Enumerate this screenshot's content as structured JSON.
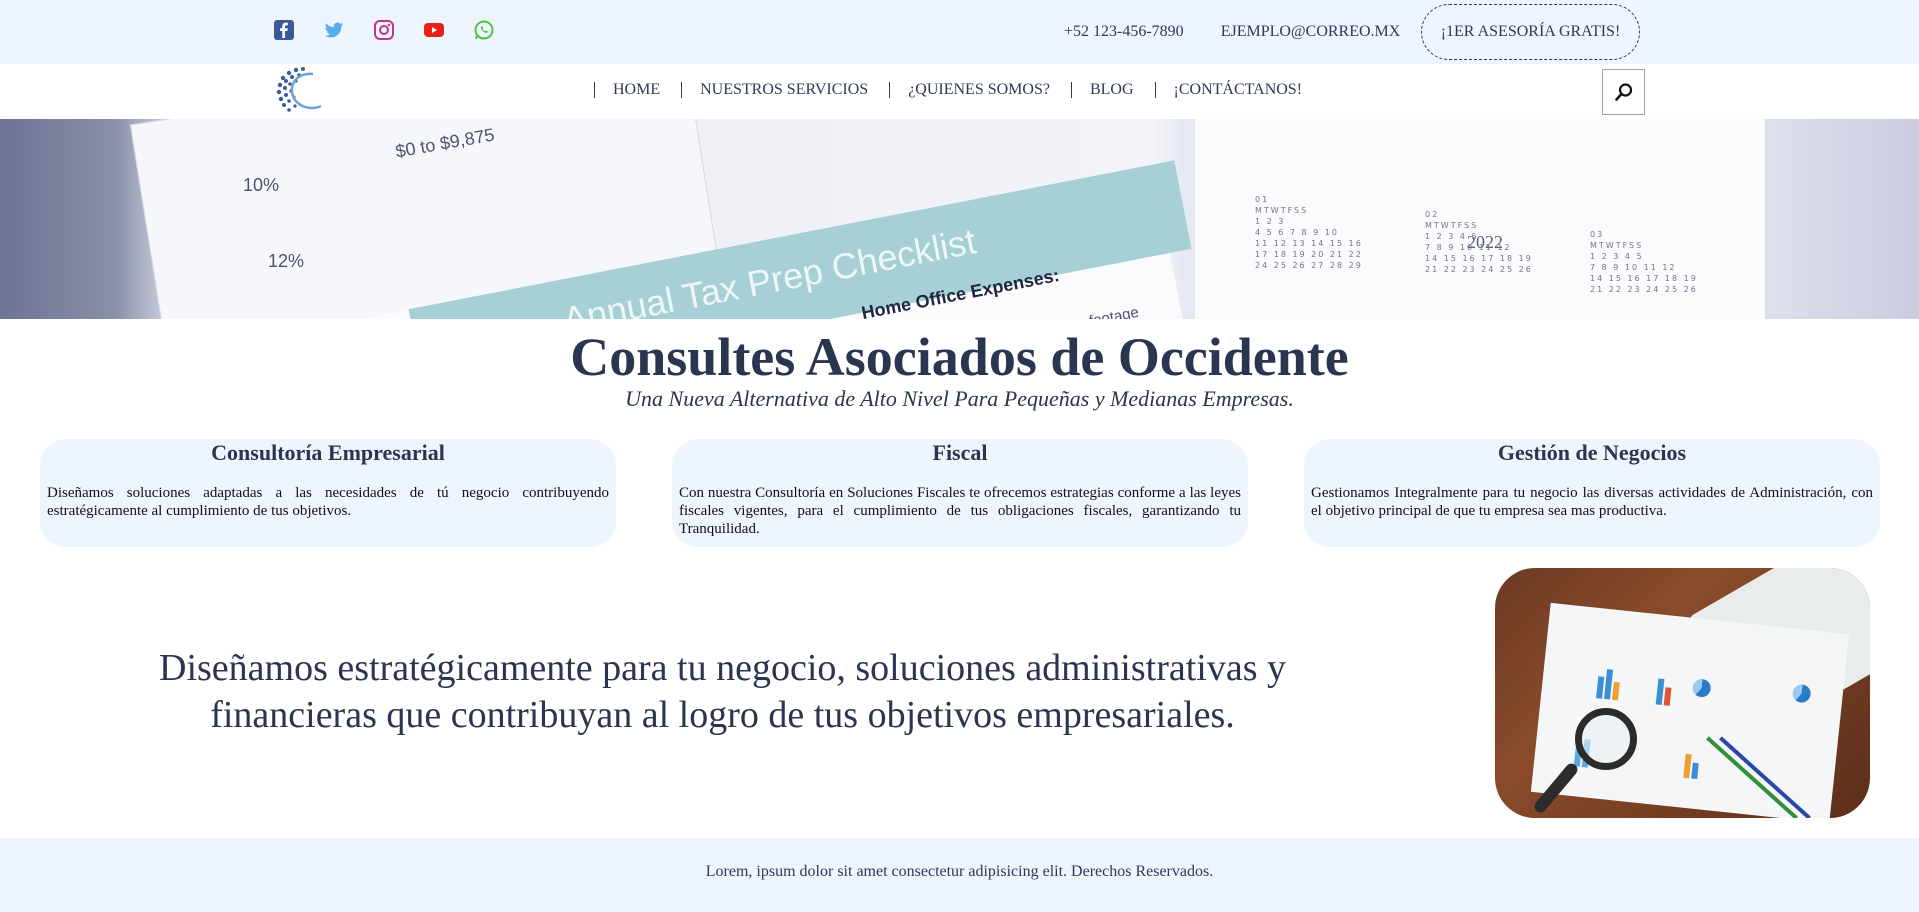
{
  "topbar": {
    "socials": [
      {
        "icon": "facebook-icon",
        "color": "#3b5998"
      },
      {
        "icon": "twitter-icon",
        "color": "#55acee"
      },
      {
        "icon": "instagram-icon",
        "color": "#c13584"
      },
      {
        "icon": "youtube-icon",
        "color": "#e62117"
      },
      {
        "icon": "whatsapp-icon",
        "color": "#4dc247"
      }
    ],
    "phone": "+52 123-456-7890",
    "email": "EJEMPLO@CORREO.MX",
    "cta": "¡1ER ASESORÍA GRATIS!"
  },
  "nav": {
    "items": [
      "HOME",
      "NUESTROS SERVICIOS",
      "¿QUIENES SOMOS?",
      "BLOG",
      "¡CONTÁCTANOS!"
    ],
    "search_icon": "search-icon"
  },
  "hero": {
    "band_text": "Annual Tax Prep Checklist",
    "expenses_text": "Home Office Expenses:",
    "sub_text": "office square footage",
    "year": "2022",
    "rate1": "10%",
    "rate2": "12%",
    "range": "$0 to $9,875"
  },
  "header": {
    "title": "Consultes Asociados de Occidente",
    "subtitle": "Una Nueva Alternativa de Alto Nivel Para Pequeñas y Medianas Empresas."
  },
  "services": [
    {
      "title": "Consultoría Empresarial",
      "text": "Diseñamos soluciones adaptadas a las necesidades de tú negocio contribuyendo estratégicamente al cumplimiento de tus objetivos."
    },
    {
      "title": "Fiscal",
      "text": "Con nuestra Consultoría en Soluciones Fiscales te ofrecemos estrategias conforme a las leyes fiscales vigentes, para el cumplimiento de tus obligaciones fiscales, garantizando tu Tranquilidad."
    },
    {
      "title": "Gestión de Negocios",
      "text": "Gestionamos Integralmente para tu negocio las diversas actividades de Administración, con el objetivo principal de que tu empresa sea mas productiva."
    }
  ],
  "tagline": "Diseñamos estratégicamente para tu negocio, soluciones administrativas y financieras que contribuyan al logro de tus objetivos empresariales.",
  "footer": {
    "text": "Lorem, ipsum dolor sit amet consectetur adipisicing elit. Derechos Reservados."
  }
}
